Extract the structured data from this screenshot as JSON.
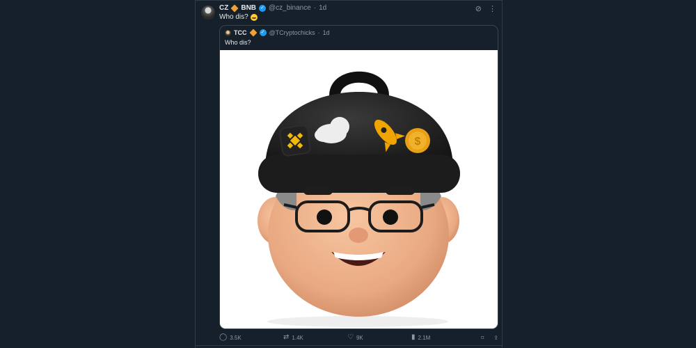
{
  "tweet": {
    "display_name": "CZ",
    "name_suffix": "BNB",
    "handle": "@cz_binance",
    "dot": "·",
    "time": "1d",
    "text": "Who dis?"
  },
  "quoted": {
    "display_name": "TCC",
    "handle": "@TCryptochicks",
    "dot": "·",
    "time": "1d",
    "text": "Who dis?"
  },
  "metrics": {
    "replies": "3.5K",
    "retweets": "1.4K",
    "likes": "9K",
    "views": "2.1M"
  },
  "icons": {
    "reply": "reply-icon",
    "retweet": "retweet-icon",
    "like": "heart-icon",
    "views": "bar-chart-icon",
    "bookmark": "bookmark-icon",
    "share": "share-icon",
    "grok": "grok-icon",
    "more": "more-icon"
  },
  "colors": {
    "background": "#15202b",
    "verified": "#1d9bf0",
    "binance": "#f0a032",
    "muted": "#8b98a5"
  }
}
